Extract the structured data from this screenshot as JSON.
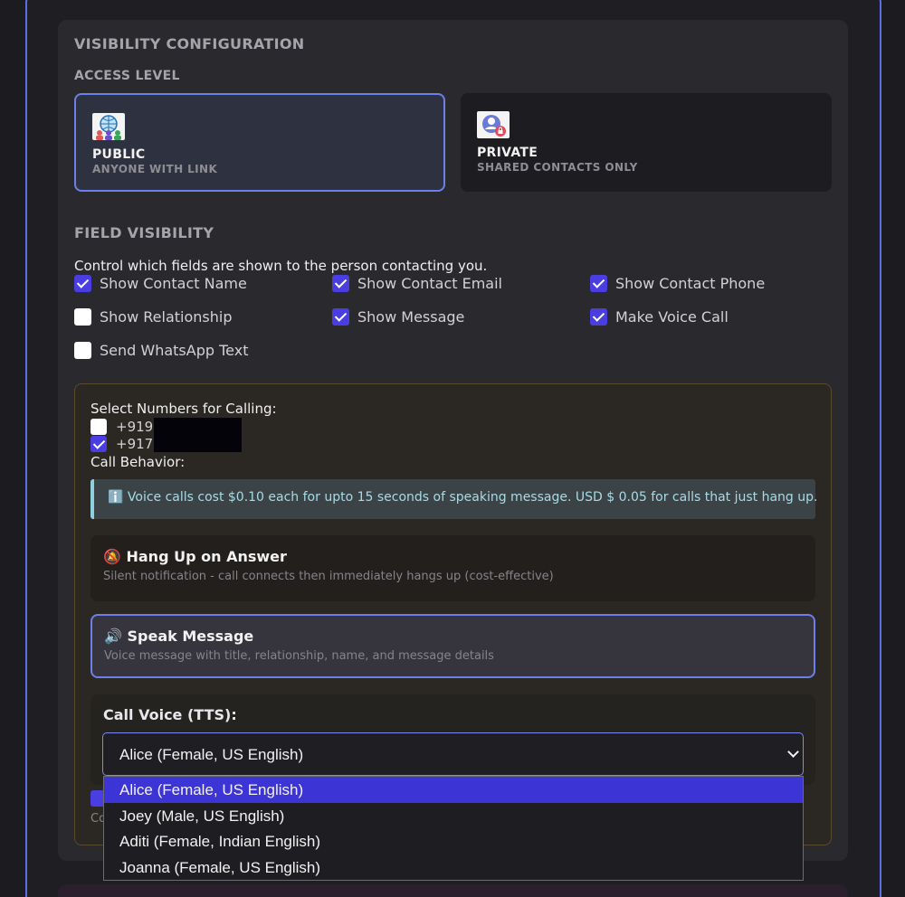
{
  "section_title": "VISIBILITY CONFIGURATION",
  "access_level": {
    "title": "ACCESS LEVEL",
    "options": [
      {
        "name": "PUBLIC",
        "desc": "ANYONE WITH LINK",
        "selected": true,
        "icon": "globe-people-icon"
      },
      {
        "name": "PRIVATE",
        "desc": "SHARED CONTACTS ONLY",
        "selected": false,
        "icon": "person-lock-icon"
      }
    ]
  },
  "field_visibility": {
    "title": "FIELD VISIBILITY",
    "intro": "Control which fields are shown to the person contacting you.",
    "fields": [
      {
        "label": "Show Contact Name",
        "checked": true
      },
      {
        "label": "Show Contact Email",
        "checked": true
      },
      {
        "label": "Show Contact Phone",
        "checked": true
      },
      {
        "label": "Show Relationship",
        "checked": false
      },
      {
        "label": "Show Message",
        "checked": true
      },
      {
        "label": "Make Voice Call",
        "checked": true
      },
      {
        "label": "Send WhatsApp Text",
        "checked": false
      }
    ]
  },
  "calling": {
    "select_numbers_label": "Select Numbers for Calling:",
    "numbers": [
      {
        "value": "+919",
        "checked": false
      },
      {
        "value": "+917",
        "checked": true
      }
    ],
    "call_behavior_label": "Call Behavior:",
    "info": "ℹ️ Voice calls cost $0.10 each for upto 15 seconds of speaking message. USD $ 0.05 for calls that just hang up.",
    "behaviors": [
      {
        "title": "🔕 Hang Up on Answer",
        "desc": "Silent notification - call connects then immediately hangs up (cost-effective)",
        "selected": false
      },
      {
        "title": "🔊 Speak Message",
        "desc": "Voice message with title, relationship, name, and message details",
        "selected": true
      }
    ],
    "voice_label": "Call Voice (TTS):",
    "voice_selected": "Alice (Female, US English)",
    "voice_options": [
      "Alice (Female, US English)",
      "Joey (Male, US English)",
      "Aditi (Female, Indian English)",
      "Joanna (Female, US English)"
    ],
    "hidden_caption_fragment": "Co"
  },
  "colors": {
    "accent": "#4a3ee0",
    "selected_border": "#6d7fe8",
    "info_text": "#a7dbe6"
  }
}
